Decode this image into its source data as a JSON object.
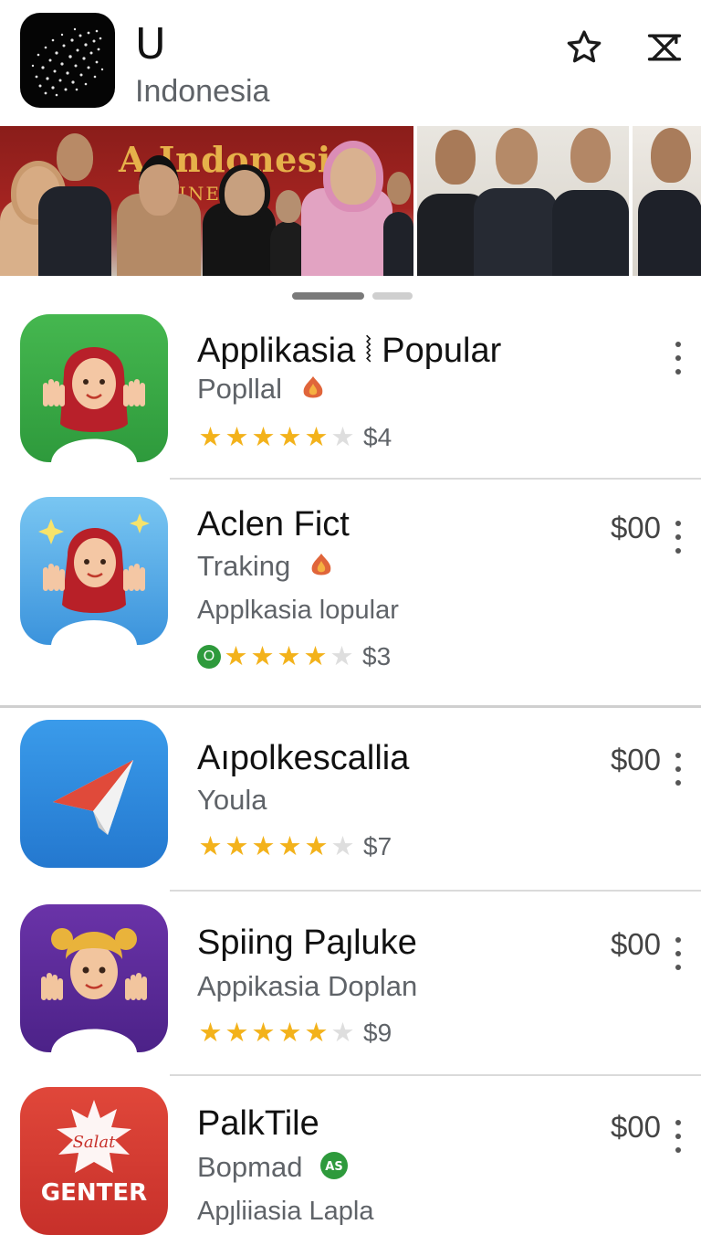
{
  "header": {
    "app_name": "U",
    "country": "Indonesia",
    "actions": [
      "star-icon",
      "share-icon"
    ]
  },
  "banner": {
    "title": "A Indonesian",
    "subtitle": "INE"
  },
  "pager": {
    "pages": 2,
    "active": 1
  },
  "apps": [
    {
      "name": "Applikasia ⦚ Popular",
      "subtitle": "Popllal",
      "badge": "flame-badge",
      "extra": "",
      "rating": 4.5,
      "price_small": "$4",
      "price": "",
      "icon": "hijab-waving-girl-green",
      "accent": "#3aa649"
    },
    {
      "name": "Aclen Fict",
      "subtitle": "Traking",
      "badge": "flame-badge",
      "extra": "Applkasia lopular",
      "rating": 4.5,
      "price_small": "$3",
      "price": "$00",
      "icon": "hijab-waving-girl-blue",
      "accent": "#4aa5e6"
    },
    {
      "name": "Aıpolkescallia",
      "subtitle": "Youla",
      "badge": "",
      "extra": "",
      "rating": 4.5,
      "price_small": "$7",
      "price": "$00",
      "icon": "paper-plane",
      "accent": "#2f8fe0"
    },
    {
      "name": "Spiing Paȷluke",
      "subtitle": "Appikasia Doplan",
      "badge": "",
      "extra": "",
      "rating": 4.5,
      "price_small": "$9",
      "price": "$00",
      "icon": "blonde-boy-purple",
      "accent": "#5b2a96"
    },
    {
      "name": "PalkTile",
      "subtitle": "Bopmad",
      "badge": "green-badge",
      "extra": "Apȷliiasia Lapla",
      "rating": 0,
      "price_small": "",
      "price": "$00",
      "icon": "genter-snowflake",
      "icon_text": "GENTER",
      "icon_text_top": "Salat",
      "accent": "#d93a2f"
    }
  ]
}
